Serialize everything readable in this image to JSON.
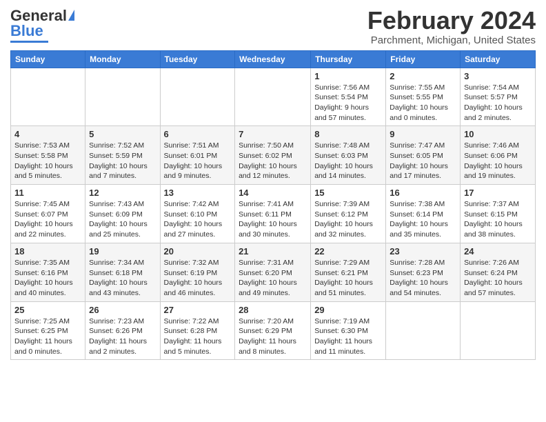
{
  "header": {
    "logo_general": "General",
    "logo_blue": "Blue",
    "title": "February 2024",
    "subtitle": "Parchment, Michigan, United States"
  },
  "days_of_week": [
    "Sunday",
    "Monday",
    "Tuesday",
    "Wednesday",
    "Thursday",
    "Friday",
    "Saturday"
  ],
  "weeks": [
    [
      {
        "day": "",
        "info": ""
      },
      {
        "day": "",
        "info": ""
      },
      {
        "day": "",
        "info": ""
      },
      {
        "day": "",
        "info": ""
      },
      {
        "day": "1",
        "info": "Sunrise: 7:56 AM\nSunset: 5:54 PM\nDaylight: 9 hours and 57 minutes."
      },
      {
        "day": "2",
        "info": "Sunrise: 7:55 AM\nSunset: 5:55 PM\nDaylight: 10 hours and 0 minutes."
      },
      {
        "day": "3",
        "info": "Sunrise: 7:54 AM\nSunset: 5:57 PM\nDaylight: 10 hours and 2 minutes."
      }
    ],
    [
      {
        "day": "4",
        "info": "Sunrise: 7:53 AM\nSunset: 5:58 PM\nDaylight: 10 hours and 5 minutes."
      },
      {
        "day": "5",
        "info": "Sunrise: 7:52 AM\nSunset: 5:59 PM\nDaylight: 10 hours and 7 minutes."
      },
      {
        "day": "6",
        "info": "Sunrise: 7:51 AM\nSunset: 6:01 PM\nDaylight: 10 hours and 9 minutes."
      },
      {
        "day": "7",
        "info": "Sunrise: 7:50 AM\nSunset: 6:02 PM\nDaylight: 10 hours and 12 minutes."
      },
      {
        "day": "8",
        "info": "Sunrise: 7:48 AM\nSunset: 6:03 PM\nDaylight: 10 hours and 14 minutes."
      },
      {
        "day": "9",
        "info": "Sunrise: 7:47 AM\nSunset: 6:05 PM\nDaylight: 10 hours and 17 minutes."
      },
      {
        "day": "10",
        "info": "Sunrise: 7:46 AM\nSunset: 6:06 PM\nDaylight: 10 hours and 19 minutes."
      }
    ],
    [
      {
        "day": "11",
        "info": "Sunrise: 7:45 AM\nSunset: 6:07 PM\nDaylight: 10 hours and 22 minutes."
      },
      {
        "day": "12",
        "info": "Sunrise: 7:43 AM\nSunset: 6:09 PM\nDaylight: 10 hours and 25 minutes."
      },
      {
        "day": "13",
        "info": "Sunrise: 7:42 AM\nSunset: 6:10 PM\nDaylight: 10 hours and 27 minutes."
      },
      {
        "day": "14",
        "info": "Sunrise: 7:41 AM\nSunset: 6:11 PM\nDaylight: 10 hours and 30 minutes."
      },
      {
        "day": "15",
        "info": "Sunrise: 7:39 AM\nSunset: 6:12 PM\nDaylight: 10 hours and 32 minutes."
      },
      {
        "day": "16",
        "info": "Sunrise: 7:38 AM\nSunset: 6:14 PM\nDaylight: 10 hours and 35 minutes."
      },
      {
        "day": "17",
        "info": "Sunrise: 7:37 AM\nSunset: 6:15 PM\nDaylight: 10 hours and 38 minutes."
      }
    ],
    [
      {
        "day": "18",
        "info": "Sunrise: 7:35 AM\nSunset: 6:16 PM\nDaylight: 10 hours and 40 minutes."
      },
      {
        "day": "19",
        "info": "Sunrise: 7:34 AM\nSunset: 6:18 PM\nDaylight: 10 hours and 43 minutes."
      },
      {
        "day": "20",
        "info": "Sunrise: 7:32 AM\nSunset: 6:19 PM\nDaylight: 10 hours and 46 minutes."
      },
      {
        "day": "21",
        "info": "Sunrise: 7:31 AM\nSunset: 6:20 PM\nDaylight: 10 hours and 49 minutes."
      },
      {
        "day": "22",
        "info": "Sunrise: 7:29 AM\nSunset: 6:21 PM\nDaylight: 10 hours and 51 minutes."
      },
      {
        "day": "23",
        "info": "Sunrise: 7:28 AM\nSunset: 6:23 PM\nDaylight: 10 hours and 54 minutes."
      },
      {
        "day": "24",
        "info": "Sunrise: 7:26 AM\nSunset: 6:24 PM\nDaylight: 10 hours and 57 minutes."
      }
    ],
    [
      {
        "day": "25",
        "info": "Sunrise: 7:25 AM\nSunset: 6:25 PM\nDaylight: 11 hours and 0 minutes."
      },
      {
        "day": "26",
        "info": "Sunrise: 7:23 AM\nSunset: 6:26 PM\nDaylight: 11 hours and 2 minutes."
      },
      {
        "day": "27",
        "info": "Sunrise: 7:22 AM\nSunset: 6:28 PM\nDaylight: 11 hours and 5 minutes."
      },
      {
        "day": "28",
        "info": "Sunrise: 7:20 AM\nSunset: 6:29 PM\nDaylight: 11 hours and 8 minutes."
      },
      {
        "day": "29",
        "info": "Sunrise: 7:19 AM\nSunset: 6:30 PM\nDaylight: 11 hours and 11 minutes."
      },
      {
        "day": "",
        "info": ""
      },
      {
        "day": "",
        "info": ""
      }
    ]
  ]
}
